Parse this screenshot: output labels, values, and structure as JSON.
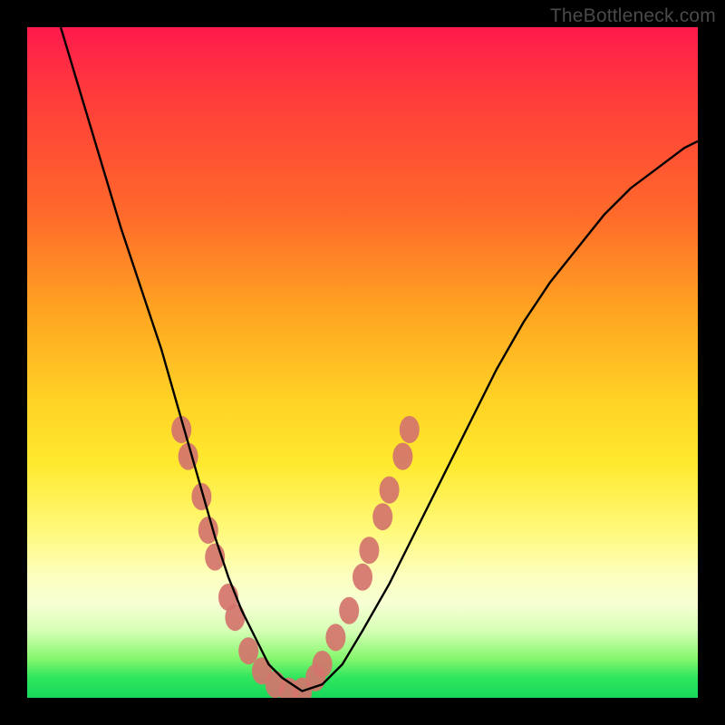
{
  "watermark": {
    "text": "TheBottleneck.com"
  },
  "colors": {
    "frame": "#000000",
    "curve": "#000000",
    "markers": "#d4746d",
    "gradient_top": "#ff1a4d",
    "gradient_bottom": "#17d85a"
  },
  "chart_data": {
    "type": "line",
    "title": "",
    "xlabel": "",
    "ylabel": "",
    "xlim": [
      0,
      100
    ],
    "ylim": [
      0,
      100
    ],
    "grid": false,
    "legend": false,
    "note": "Axes are unlabeled in the image; values are estimated on a 0–100 normalized scale from pixel positions.",
    "series": [
      {
        "name": "curve",
        "x": [
          5,
          8,
          11,
          14,
          17,
          20,
          22,
          24,
          26,
          28,
          30,
          32,
          34,
          36,
          38,
          41,
          44,
          47,
          50,
          54,
          58,
          62,
          66,
          70,
          74,
          78,
          82,
          86,
          90,
          94,
          98,
          100
        ],
        "y": [
          100,
          90,
          80,
          70,
          61,
          52,
          45,
          38,
          31,
          24,
          18,
          13,
          9,
          5,
          3,
          1,
          2,
          5,
          10,
          17,
          25,
          33,
          41,
          49,
          56,
          62,
          67,
          72,
          76,
          79,
          82,
          83
        ]
      }
    ],
    "markers": {
      "name": "highlighted-points",
      "note": "Pink oval markers clustered near the curve minimum on both branches.",
      "points": [
        {
          "x": 23,
          "y": 40
        },
        {
          "x": 24,
          "y": 36
        },
        {
          "x": 26,
          "y": 30
        },
        {
          "x": 27,
          "y": 25
        },
        {
          "x": 28,
          "y": 21
        },
        {
          "x": 30,
          "y": 15
        },
        {
          "x": 31,
          "y": 12
        },
        {
          "x": 33,
          "y": 7
        },
        {
          "x": 35,
          "y": 4
        },
        {
          "x": 37,
          "y": 2
        },
        {
          "x": 39,
          "y": 1
        },
        {
          "x": 41,
          "y": 1
        },
        {
          "x": 43,
          "y": 3
        },
        {
          "x": 44,
          "y": 5
        },
        {
          "x": 46,
          "y": 9
        },
        {
          "x": 48,
          "y": 13
        },
        {
          "x": 50,
          "y": 18
        },
        {
          "x": 51,
          "y": 22
        },
        {
          "x": 53,
          "y": 27
        },
        {
          "x": 54,
          "y": 31
        },
        {
          "x": 56,
          "y": 36
        },
        {
          "x": 57,
          "y": 40
        }
      ]
    }
  }
}
